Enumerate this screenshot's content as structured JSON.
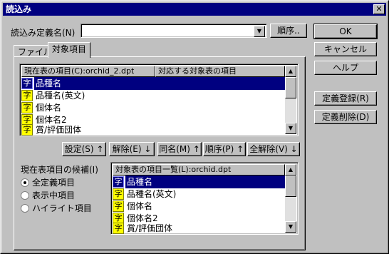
{
  "window": {
    "title": "読込み",
    "close": "✕"
  },
  "definition": {
    "label": "読込み定義名(N)",
    "value": "",
    "order_button": "順序.."
  },
  "side_buttons": {
    "ok": "OK",
    "cancel": "キャンセル",
    "help": "ヘルプ",
    "register": "定義登録(R)",
    "delete": "定義削除(D)"
  },
  "tabs": [
    {
      "label": "ファイル"
    },
    {
      "label": "対象項目"
    }
  ],
  "mapping_list": {
    "headers": [
      "現在表の項目(C):orchid_2.dpt",
      "対応する対象表の項目"
    ],
    "rows": [
      {
        "icon": "字",
        "name": "品種名",
        "selected": true
      },
      {
        "icon": "字",
        "name": "品種名(英文)",
        "selected": false
      },
      {
        "icon": "字",
        "name": "個体名",
        "selected": false
      },
      {
        "icon": "字",
        "name": "個体名2",
        "selected": false
      },
      {
        "icon": "字",
        "name": "賞/評価団体",
        "selected": false
      }
    ]
  },
  "action_buttons": {
    "set": "設定(S) ↑",
    "release": "解除(E) ↓",
    "same_name": "同名(M) ↑",
    "order": "順序(P) ↑",
    "release_all": "全解除(V) ↓"
  },
  "candidates": {
    "label": "現在表項目の候補(I)",
    "options": [
      {
        "label": "全定義項目",
        "checked": true
      },
      {
        "label": "表示中項目",
        "checked": false
      },
      {
        "label": "ハイライト項目",
        "checked": false
      }
    ]
  },
  "target_list": {
    "header": "対象表の項目一覧(L):orchid.dpt",
    "rows": [
      {
        "icon": "字",
        "name": "品種名",
        "selected": true
      },
      {
        "icon": "字",
        "name": "品種名(英文)",
        "selected": false
      },
      {
        "icon": "字",
        "name": "個体名",
        "selected": false
      },
      {
        "icon": "字",
        "name": "個体名2",
        "selected": false
      },
      {
        "icon": "字",
        "name": "賞/評価団体",
        "selected": false
      }
    ]
  },
  "colors": {
    "titlebar": "#000080",
    "face": "#c0c0c0",
    "selection": "#000080",
    "field_icon": "#ffff00"
  }
}
